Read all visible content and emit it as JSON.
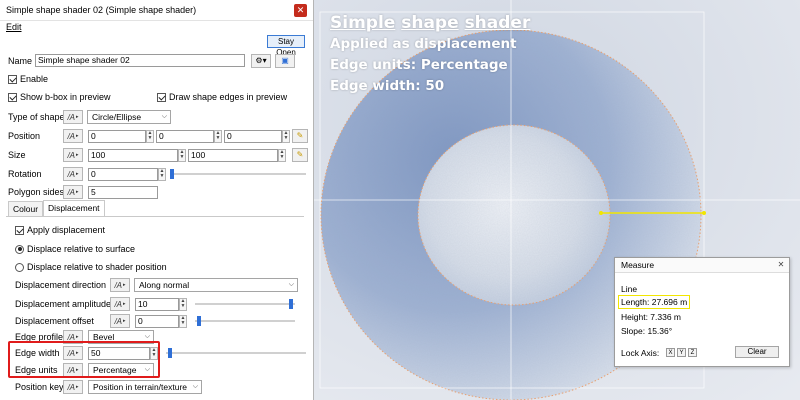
{
  "window": {
    "title": "Simple shape shader 02    (Simple shape shader)",
    "close_icon": "close-icon",
    "menu_edit": "Edit",
    "stay_open": "Stay Open"
  },
  "form": {
    "name_label": "Name",
    "name_value": "Simple shape shader 02",
    "enable_label": "Enable",
    "show_bbox_label": "Show b-box in preview",
    "draw_edges_label": "Draw shape edges in preview",
    "type_label": "Type of shape",
    "type_value": "Circle/Ellipse",
    "position_label": "Position",
    "position_values": [
      "0",
      "0",
      "0"
    ],
    "size_label": "Size",
    "size_values": [
      "100",
      "100"
    ],
    "rotation_label": "Rotation",
    "rotation_value": "0",
    "polygon_label": "Polygon sides",
    "polygon_value": "5"
  },
  "tabs": [
    "Colour",
    "Displacement"
  ],
  "displacement": {
    "apply_label": "Apply displacement",
    "relative_surface_label": "Displace relative to surface",
    "relative_position_label": "Displace relative to shader position",
    "direction_label": "Displacement direction",
    "direction_value": "Along normal",
    "amplitude_label": "Displacement amplitude",
    "amplitude_value": "10",
    "offset_label": "Displacement offset",
    "offset_value": "0",
    "edge_profile_label": "Edge profile",
    "edge_profile_value": "Bevel",
    "edge_width_label": "Edge width",
    "edge_width_value": "50",
    "edge_units_label": "Edge units",
    "edge_units_value": "Percentage",
    "position_key_label": "Position key",
    "position_key_value": "Position in terrain/texture"
  },
  "overlay": {
    "heading": [
      "Simple",
      "shape",
      "shader"
    ],
    "line1": "Applied as displacement",
    "line2": "Edge units: Percentage",
    "line3": "Edge width: 50"
  },
  "measure": {
    "title": "Measure",
    "section": "Line",
    "length": "Length: 27.696 m",
    "height": "Height: 7.336 m",
    "slope": "Slope: 15.36°",
    "lock_axis": "Lock Axis:",
    "axes": [
      "X",
      "Y",
      "Z"
    ],
    "clear": "Clear"
  },
  "colors": {
    "highlight_red": "#e01b1b",
    "highlight_yellow": "#f2e600",
    "accent_blue": "#2f6fd6"
  }
}
